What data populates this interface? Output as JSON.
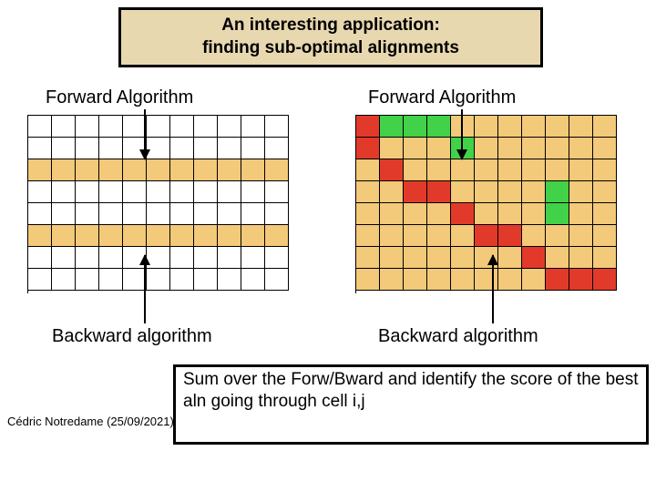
{
  "title": {
    "line1": "An interesting application:",
    "line2": "finding sub-optimal alignments"
  },
  "labels": {
    "forward_left": "Forward Algorithm",
    "forward_right": "Forward Algorithm",
    "backward_left": "Backward algorithm",
    "backward_right": "Backward algorithm"
  },
  "summary": "Sum over the Forw/Bward and identify the score of the best aln going through cell i,j",
  "footer": "Cédric Notredame (25/09/2021)",
  "grids": {
    "rows": 8,
    "cols": 11,
    "left": [
      [
        "",
        "",
        "",
        "",
        "",
        "",
        "",
        "",
        "",
        "",
        ""
      ],
      [
        "",
        "",
        "",
        "",
        "",
        "",
        "",
        "",
        "",
        "",
        ""
      ],
      [
        "o",
        "o",
        "o",
        "o",
        "o",
        "o",
        "o",
        "o",
        "o",
        "o",
        "o"
      ],
      [
        "",
        "",
        "",
        "",
        "",
        "",
        "",
        "",
        "",
        "",
        ""
      ],
      [
        "",
        "",
        "",
        "",
        "",
        "",
        "",
        "",
        "",
        "",
        ""
      ],
      [
        "o",
        "o",
        "o",
        "o",
        "o",
        "o",
        "o",
        "o",
        "o",
        "o",
        "o"
      ],
      [
        "",
        "",
        "",
        "",
        "",
        "",
        "",
        "",
        "",
        "",
        ""
      ],
      [
        "",
        "",
        "",
        "",
        "",
        "",
        "",
        "",
        "",
        "",
        ""
      ]
    ],
    "right": [
      [
        "r",
        "g",
        "g",
        "g",
        "o",
        "o",
        "o",
        "o",
        "o",
        "o",
        "o"
      ],
      [
        "r",
        "o",
        "o",
        "o",
        "g",
        "o",
        "o",
        "o",
        "o",
        "o",
        "o"
      ],
      [
        "o",
        "r",
        "o",
        "o",
        "o",
        "o",
        "o",
        "o",
        "o",
        "o",
        "o"
      ],
      [
        "o",
        "o",
        "r",
        "r",
        "o",
        "o",
        "o",
        "o",
        "g",
        "o",
        "o"
      ],
      [
        "o",
        "o",
        "o",
        "o",
        "r",
        "o",
        "o",
        "o",
        "g",
        "o",
        "o"
      ],
      [
        "o",
        "o",
        "o",
        "o",
        "o",
        "r",
        "r",
        "o",
        "o",
        "o",
        "o"
      ],
      [
        "o",
        "o",
        "o",
        "o",
        "o",
        "o",
        "o",
        "r",
        "o",
        "o",
        "o"
      ],
      [
        "o",
        "o",
        "o",
        "o",
        "o",
        "o",
        "o",
        "o",
        "r",
        "r",
        "r"
      ]
    ]
  }
}
